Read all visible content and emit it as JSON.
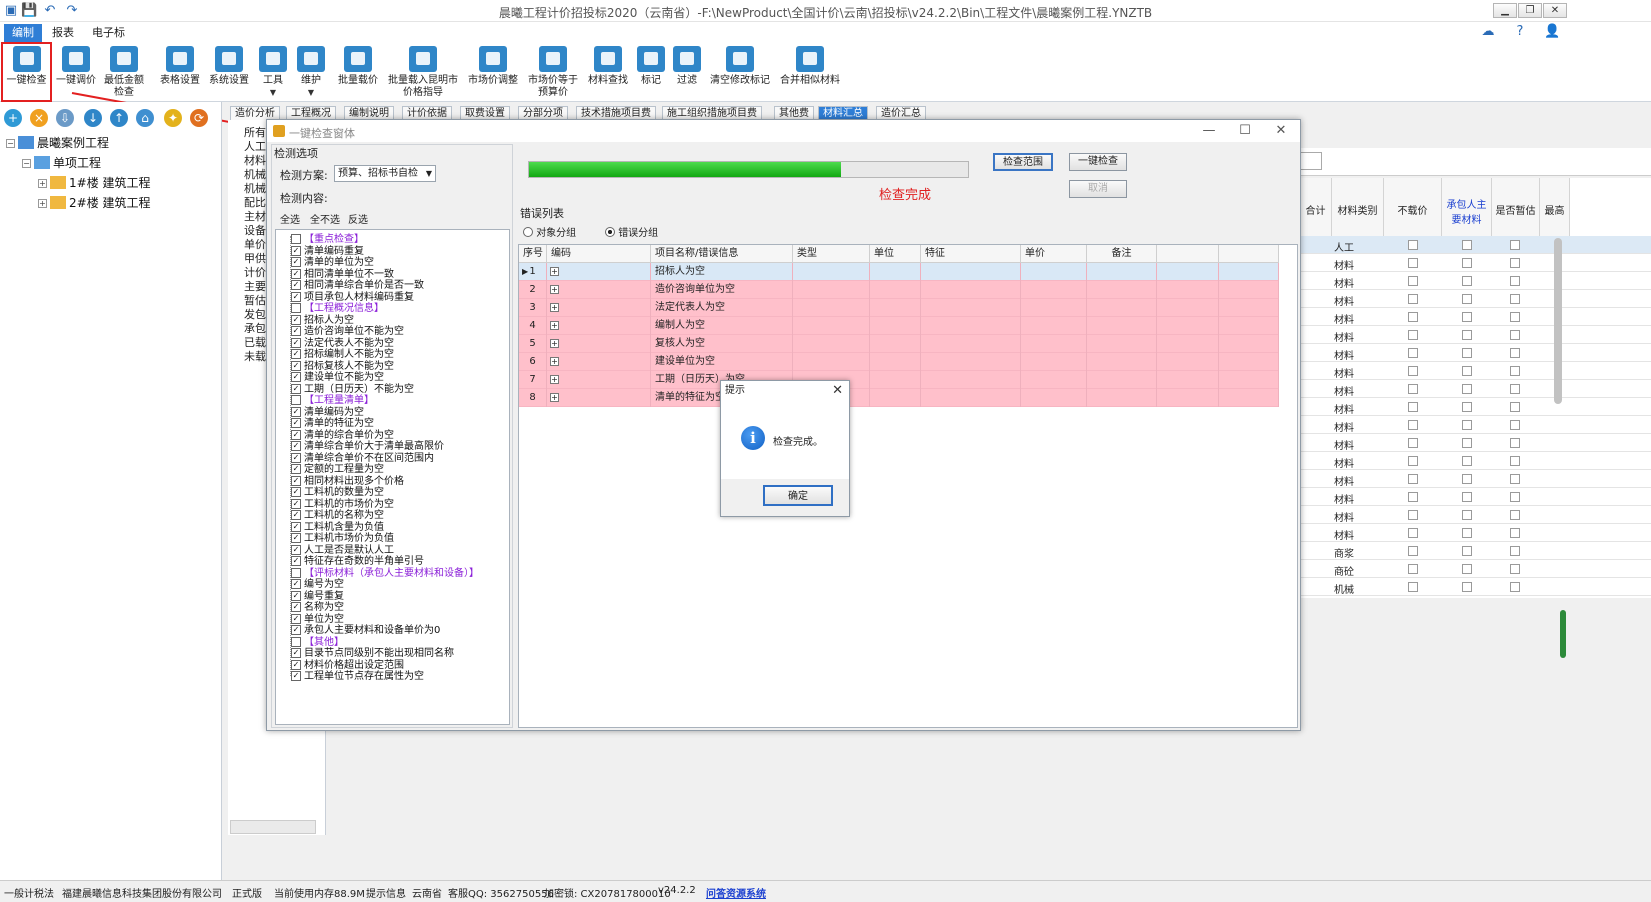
{
  "window": {
    "title": "晨曦工程计价招投标2020（云南省）-F:\\NewProduct\\全国计价\\云南\\招投标\\v24.2.2\\Bin\\工程文件\\晨曦案例工程.YNZTB"
  },
  "menu": {
    "tabs": [
      "编制",
      "报表",
      "电子标"
    ],
    "active": 0
  },
  "ribbon": {
    "buttons": [
      {
        "label": "一键检查",
        "icon": "one-click-check-icon"
      },
      {
        "label": "一键调价",
        "icon": "one-click-adjust-icon"
      },
      {
        "label": "最低金额",
        "label2": "检查",
        "icon": "min-amount-check-icon"
      },
      {
        "label": "表格设置",
        "icon": "table-settings-icon"
      },
      {
        "label": "系统设置",
        "icon": "system-settings-icon"
      },
      {
        "label": "工具",
        "icon": "toolbox-icon"
      },
      {
        "label": "维护",
        "icon": "maintenance-icon"
      },
      {
        "label": "批量载价",
        "icon": "batch-price-icon"
      },
      {
        "label": "批量载入昆明市",
        "label2": "价格指导",
        "icon": "kunming-price-icon"
      },
      {
        "label": "市场价调整",
        "icon": "market-price-icon"
      },
      {
        "label": "市场价等于",
        "label2": "预算价",
        "icon": "balance-scale-icon"
      },
      {
        "label": "材料查找",
        "icon": "material-search-icon"
      },
      {
        "label": "标记",
        "icon": "flag-icon"
      },
      {
        "label": "过滤",
        "icon": "filter-icon"
      },
      {
        "label": "清空修改标记",
        "icon": "broom-icon"
      },
      {
        "label": "合并相似材料",
        "icon": "merge-icon"
      }
    ]
  },
  "tree": {
    "root": "晨曦案例工程",
    "child": "单项工程",
    "leaves": [
      "1#楼  建筑工程",
      "2#楼  建筑工程"
    ]
  },
  "page_tabs": [
    "造价分析",
    "工程概况",
    "编制说明",
    "计价依据",
    "取费设置",
    "分部分项",
    "技术措施项目费",
    "施工组织措施项目费",
    "其他费",
    "材料汇总",
    "造价汇总"
  ],
  "page_tabs_active": 9,
  "bg_list": [
    "所有",
    "人工",
    "材料",
    "机械",
    "机械",
    "配比",
    "主材",
    "设备",
    "单价",
    "甲供",
    "计价",
    "主要",
    "暂估",
    "发包",
    "承包",
    "已载",
    "未载"
  ],
  "right_table": {
    "headers": [
      "合计",
      "材料类别",
      "不载价",
      "承包人主要材料",
      "是否暂估",
      "最高"
    ],
    "categories": [
      "人工",
      "材料",
      "材料",
      "材料",
      "材料",
      "材料",
      "材料",
      "材料",
      "材料",
      "材料",
      "材料",
      "材料",
      "材料",
      "材料",
      "材料",
      "材料",
      "材料",
      "商浆",
      "商砼",
      "机械"
    ]
  },
  "dialog": {
    "title": "一键检查窗体",
    "options_label": "检测选项",
    "scheme_label": "检测方案:",
    "scheme_value": "预算、招标书自检",
    "content_label": "检测内容:",
    "select_all": "全选",
    "select_none": "全不选",
    "invert": "反选",
    "checklist": [
      {
        "text": "【重点检查】",
        "header": true,
        "checked": false
      },
      {
        "text": "清单编码重复",
        "checked": true
      },
      {
        "text": "清单的单位为空",
        "checked": true
      },
      {
        "text": "相同清单单位不一致",
        "checked": true
      },
      {
        "text": "相同清单综合单价是否一致",
        "checked": true
      },
      {
        "text": "项目承包人材料编码重复",
        "checked": true
      },
      {
        "text": "【工程概况信息】",
        "header": true,
        "checked": false
      },
      {
        "text": "招标人为空",
        "checked": true
      },
      {
        "text": "造价咨询单位不能为空",
        "checked": true
      },
      {
        "text": "法定代表人不能为空",
        "checked": true
      },
      {
        "text": "招标编制人不能为空",
        "checked": true
      },
      {
        "text": "招标复核人不能为空",
        "checked": true
      },
      {
        "text": "建设单位不能为空",
        "checked": true
      },
      {
        "text": "工期（日历天）不能为空",
        "checked": true
      },
      {
        "text": "【工程量清单】",
        "header": true,
        "checked": false
      },
      {
        "text": "清单编码为空",
        "checked": true
      },
      {
        "text": "清单的特征为空",
        "checked": true
      },
      {
        "text": "清单的综合单价为空",
        "checked": true
      },
      {
        "text": "清单综合单价大于清单最高限价",
        "checked": true
      },
      {
        "text": "清单综合单价不在区间范围内",
        "checked": true
      },
      {
        "text": "定额的工程量为空",
        "checked": true
      },
      {
        "text": "相同材料出现多个价格",
        "checked": true
      },
      {
        "text": "工料机的数量为空",
        "checked": true
      },
      {
        "text": "工料机的市场价为空",
        "checked": true
      },
      {
        "text": "工料机的名称为空",
        "checked": true
      },
      {
        "text": "工料机含量为负值",
        "checked": true
      },
      {
        "text": "工料机市场价为负值",
        "checked": true
      },
      {
        "text": "人工是否是默认人工",
        "checked": true
      },
      {
        "text": "特征存在奇数的半角单引号",
        "checked": true
      },
      {
        "text": "【评标材料（承包人主要材料和设备）】",
        "header": true,
        "checked": false
      },
      {
        "text": "编号为空",
        "checked": true
      },
      {
        "text": "编号重复",
        "checked": true
      },
      {
        "text": "名称为空",
        "checked": true
      },
      {
        "text": "单位为空",
        "checked": true
      },
      {
        "text": "承包人主要材料和设备单价为0",
        "checked": true
      },
      {
        "text": "【其他】",
        "header": true,
        "checked": false
      },
      {
        "text": "目录节点同级别不能出现相同名称",
        "checked": true
      },
      {
        "text": "材料价格超出设定范围",
        "checked": true
      },
      {
        "text": "工程单位节点存在属性为空",
        "checked": true
      }
    ],
    "progress": 0.71,
    "status": "检查完成",
    "btn_scope": "检查范围",
    "btn_check": "一键检查",
    "btn_cancel": "取消",
    "error_list_label": "错误列表",
    "radio_object": "对象分组",
    "radio_error": "错误分组",
    "columns": [
      "序号",
      "编码",
      "项目名称/错误信息",
      "类型",
      "单位",
      "特征",
      "单价",
      "备注"
    ],
    "errors": [
      {
        "no": "1",
        "msg": "招标人为空"
      },
      {
        "no": "2",
        "msg": "造价咨询单位为空"
      },
      {
        "no": "3",
        "msg": "法定代表人为空"
      },
      {
        "no": "4",
        "msg": "编制人为空"
      },
      {
        "no": "5",
        "msg": "复核人为空"
      },
      {
        "no": "6",
        "msg": "建设单位为空"
      },
      {
        "no": "7",
        "msg": "工期（日历天）为空"
      },
      {
        "no": "8",
        "msg": "清单的特征为空"
      }
    ],
    "colors": {
      "error_row": "#ffc0cb",
      "selected_row": "#d9e8f6",
      "status_red": "#e02020"
    }
  },
  "messagebox": {
    "title": "提示",
    "text": "检查完成。",
    "ok": "确定"
  },
  "statusbar": {
    "items": [
      "一般计税法",
      "福建晨曦信息科技集团股份有限公司",
      "正式版",
      "当前使用内存88.9M",
      "提示信息",
      "云南省",
      "客服QQ: 3562750556",
      "加密锁: CX207817800010",
      "v24.2.2"
    ],
    "link": "问答资源系统"
  }
}
